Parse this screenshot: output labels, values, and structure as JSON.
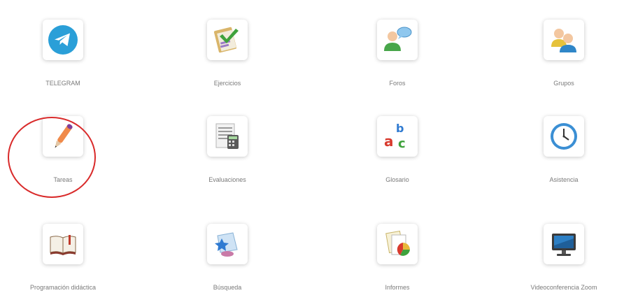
{
  "tools": [
    {
      "label": "TELEGRAM",
      "icon": "telegram-icon"
    },
    {
      "label": "Ejercicios",
      "icon": "exercises-icon"
    },
    {
      "label": "Foros",
      "icon": "forums-icon"
    },
    {
      "label": "Grupos",
      "icon": "groups-icon"
    },
    {
      "label": "Tareas",
      "icon": "tasks-pen-icon"
    },
    {
      "label": "Evaluaciones",
      "icon": "evaluations-icon"
    },
    {
      "label": "Glosario",
      "icon": "glossary-icon"
    },
    {
      "label": "Asistencia",
      "icon": "attendance-clock-icon"
    },
    {
      "label": "Programación didáctica",
      "icon": "syllabus-book-icon"
    },
    {
      "label": "Búsqueda",
      "icon": "search-icon"
    },
    {
      "label": "Informes",
      "icon": "reports-icon"
    },
    {
      "label": "Videoconferencia Zoom",
      "icon": "videoconference-monitor-icon"
    }
  ],
  "highlight": {
    "target": "Tareas",
    "color": "#d92b2b"
  },
  "colors": {
    "label_text": "#7a7a7a",
    "telegram_blue": "#2a9fd8"
  }
}
